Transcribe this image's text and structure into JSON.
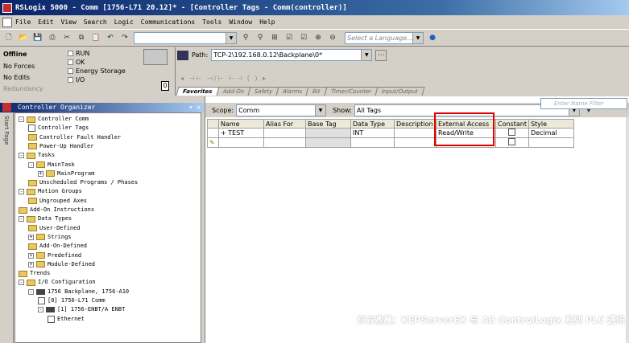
{
  "window": {
    "title": "RSLogix 5000 - Comm [1756-L71 20.12]* - [Controller Tags - Comm(controller)]"
  },
  "menu": [
    "File",
    "Edit",
    "View",
    "Search",
    "Logic",
    "Communications",
    "Tools",
    "Window",
    "Help"
  ],
  "toolbar": {
    "language_placeholder": "Select a Language..."
  },
  "status": {
    "mode": "Offline",
    "forces": "No Forces",
    "edits": "No Edits",
    "redundancy": "Redundancy",
    "run_label": "RUN",
    "ok_label": "OK",
    "energy_label": "Energy Storage",
    "io_label": "I/O",
    "step": "0"
  },
  "path": {
    "label": "Path:",
    "value": "TCP-2\\192.168.0.12\\Backplane\\0*"
  },
  "instruction_tabs": [
    "Favorites",
    "Add-On",
    "Safety",
    "Alarms",
    "Bit",
    "Timer/Counter",
    "Input/Output"
  ],
  "organizer": {
    "title": "Controller Organizer",
    "side_label": "Start Page",
    "tree": [
      {
        "level": 0,
        "label": "Controller Comm",
        "kind": "folder",
        "pm": "-"
      },
      {
        "level": 1,
        "label": "Controller Tags",
        "kind": "doc"
      },
      {
        "level": 1,
        "label": "Controller Fault Handler",
        "kind": "folder"
      },
      {
        "level": 1,
        "label": "Power-Up Handler",
        "kind": "folder"
      },
      {
        "level": 0,
        "label": "Tasks",
        "kind": "folder",
        "pm": "-"
      },
      {
        "level": 1,
        "label": "MainTask",
        "kind": "folder",
        "pm": "-"
      },
      {
        "level": 2,
        "label": "MainProgram",
        "kind": "folder",
        "pm": "+"
      },
      {
        "level": 1,
        "label": "Unscheduled Programs / Phases",
        "kind": "folder"
      },
      {
        "level": 0,
        "label": "Motion Groups",
        "kind": "folder",
        "pm": "-"
      },
      {
        "level": 1,
        "label": "Ungrouped Axes",
        "kind": "folder"
      },
      {
        "level": 0,
        "label": "Add-On Instructions",
        "kind": "folder"
      },
      {
        "level": 0,
        "label": "Data Types",
        "kind": "folder",
        "pm": "-"
      },
      {
        "level": 1,
        "label": "User-Defined",
        "kind": "folder"
      },
      {
        "level": 1,
        "label": "Strings",
        "kind": "folder",
        "pm": "+"
      },
      {
        "level": 1,
        "label": "Add-On-Defined",
        "kind": "folder"
      },
      {
        "level": 1,
        "label": "Predefined",
        "kind": "folder",
        "pm": "+"
      },
      {
        "level": 1,
        "label": "Module-Defined",
        "kind": "folder",
        "pm": "+"
      },
      {
        "level": 0,
        "label": "Trends",
        "kind": "folder"
      },
      {
        "level": 0,
        "label": "I/O Configuration",
        "kind": "folder",
        "pm": "-"
      },
      {
        "level": 1,
        "label": "1756 Backplane, 1756-A10",
        "kind": "mod",
        "pm": "-"
      },
      {
        "level": 2,
        "label": "[0] 1756-L71 Comm",
        "kind": "doc"
      },
      {
        "level": 2,
        "label": "[1] 1756-ENBT/A ENBT",
        "kind": "mod",
        "pm": "-"
      },
      {
        "level": 3,
        "label": "Ethernet",
        "kind": "doc"
      }
    ]
  },
  "grid": {
    "scope_label": "Scope:",
    "scope_value": "Comm",
    "show_label": "Show:",
    "show_value": "All Tags",
    "filter_placeholder": "Enter Name Filter",
    "columns": [
      "Name",
      "Alias For",
      "Base Tag",
      "Data Type",
      "Description",
      "External Access",
      "Constant",
      "Style"
    ],
    "rows": [
      {
        "marker": "",
        "name": "+ TEST",
        "alias": "",
        "base": "",
        "type": "INT",
        "desc": "",
        "access": "Read/Write",
        "constant": false,
        "style": "Decimal"
      },
      {
        "marker": "✎",
        "name": "",
        "alias": "",
        "base": "",
        "type": "",
        "desc": "",
        "access": "",
        "constant": false,
        "style": ""
      }
    ]
  },
  "watermark": "东方鼎晨：KEPServerEX 与 AB ControlLogix 系列 PLC 通讯"
}
